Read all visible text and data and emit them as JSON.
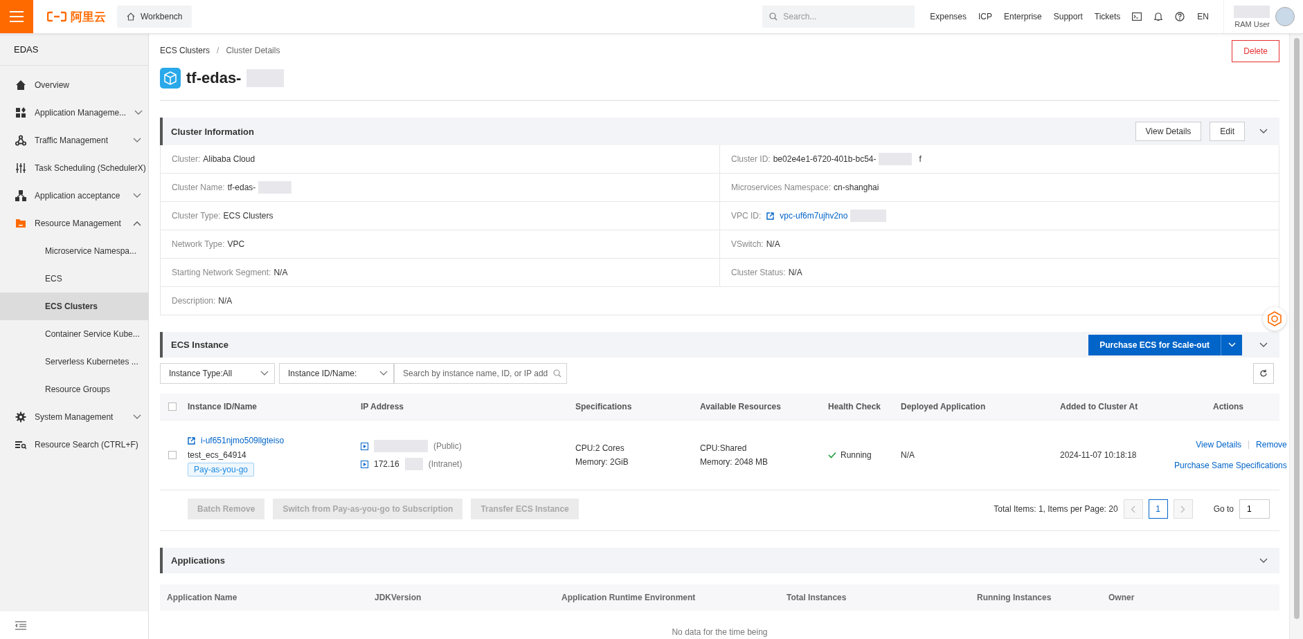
{
  "topbar": {
    "logo_text": "阿里云",
    "workbench": "Workbench",
    "search": {
      "placeholder": "Search..."
    },
    "links": [
      "Expenses",
      "ICP",
      "Enterprise",
      "Support",
      "Tickets"
    ],
    "language": "EN",
    "user_role": "RAM User"
  },
  "sidebar": {
    "title": "EDAS",
    "items": [
      {
        "label": "Overview",
        "kind": "home"
      },
      {
        "label": "Application Manageme...",
        "kind": "apps",
        "expanded": false
      },
      {
        "label": "Traffic Management",
        "kind": "traffic",
        "expanded": false
      },
      {
        "label": "Task Scheduling (SchedulerX)",
        "kind": "sliders"
      },
      {
        "label": "Application acceptance",
        "kind": "nodes",
        "expanded": false
      },
      {
        "label": "Resource Management",
        "kind": "folder",
        "expanded": true,
        "children": [
          {
            "label": "Microservice Namespa...",
            "selected": false
          },
          {
            "label": "ECS",
            "selected": false
          },
          {
            "label": "ECS Clusters",
            "selected": true
          },
          {
            "label": "Container Service Kube...",
            "selected": false
          },
          {
            "label": "Serverless Kubernetes ...",
            "selected": false
          },
          {
            "label": "Resource Groups",
            "selected": false
          }
        ]
      },
      {
        "label": "System Management",
        "kind": "gear",
        "expanded": false
      },
      {
        "label": "Resource Search (CTRL+F)",
        "kind": "searchlist"
      }
    ]
  },
  "breadcrumb": {
    "items": [
      "ECS Clusters",
      "Cluster Details"
    ],
    "separator": "/"
  },
  "title": {
    "text": "tf-edas-",
    "masked": true
  },
  "delete_button": "Delete",
  "cluster_info": {
    "title": "Cluster Information",
    "buttons": [
      "View Details",
      "Edit"
    ],
    "fields": [
      {
        "label": "Cluster:",
        "value": "Alibaba Cloud",
        "kind": "text"
      },
      {
        "label": "Cluster ID:",
        "value": "be02e4e1-6720-401b-bc54-",
        "masked": true,
        "suffix": "f",
        "kind": "text"
      },
      {
        "label": "Cluster Name:",
        "value": "tf-edas-",
        "masked": true,
        "kind": "text"
      },
      {
        "label": "Microservices Namespace:",
        "value": "cn-shanghai",
        "kind": "text"
      },
      {
        "label": "Cluster Type:",
        "value": "ECS Clusters",
        "kind": "text"
      },
      {
        "label": "VPC ID:",
        "value": "vpc-uf6m7ujhv2no",
        "masked": true,
        "kind": "link"
      },
      {
        "label": "Network Type:",
        "value": "VPC",
        "kind": "text"
      },
      {
        "label": "VSwitch:",
        "value": "N/A",
        "kind": "text"
      },
      {
        "label": "Starting Network Segment:",
        "value": "N/A",
        "kind": "text"
      },
      {
        "label": "Cluster Status:",
        "value": "N/A",
        "kind": "text"
      },
      {
        "label": "Description:",
        "value": "N/A",
        "kind": "wide"
      }
    ]
  },
  "ecs_instance": {
    "title": "ECS Instance",
    "purchase_button": "Purchase ECS for Scale-out",
    "filters": [
      "Instance Type:All",
      "Instance ID/Name:"
    ],
    "search": {
      "placeholder": "Search by instance name, ID, or IP add"
    },
    "columns": [
      "Instance ID/Name",
      "IP Address",
      "Specifications",
      "Available Resources",
      "Health Check",
      "Deployed Application",
      "Added to Cluster At",
      "Actions"
    ],
    "header_checked": false,
    "rows": [
      {
        "checked": false,
        "instance_id": "i-uf651njmo509llgteiso",
        "name": "test_ecs_64914",
        "billing": "Pay-as-you-go",
        "ips": [
          {
            "masked": true,
            "tag": "(Public)"
          },
          {
            "address": "172.16",
            "masked": true,
            "tag": "(Intranet)"
          }
        ],
        "specs": [
          "CPU:2 Cores",
          "Memory: 2GiB"
        ],
        "resources": [
          "CPU:Shared",
          "Memory: 2048 MB"
        ],
        "health": "Running",
        "deployed": "N/A",
        "added": "2024-11-07 10:18:18",
        "actions": [
          "View Details",
          "Remove",
          "Purchase Same Specifications"
        ]
      }
    ],
    "footer_buttons": [
      {
        "label": "Batch Remove",
        "disabled": true
      },
      {
        "label": "Switch from Pay-as-you-go to Subscription",
        "disabled": true
      },
      {
        "label": "Transfer ECS Instance",
        "disabled": true
      }
    ],
    "pagination": {
      "summary": "Total Items: 1, Items per Page: 20",
      "pages": [
        {
          "label": "1",
          "selected": true
        }
      ],
      "goto_label": "Go to",
      "goto_value": "1"
    }
  },
  "applications": {
    "title": "Applications",
    "columns": [
      "Application Name",
      "JDKVersion",
      "Application Runtime Environment",
      "Total Instances",
      "Running Instances",
      "Owner"
    ],
    "empty_text": "No data for the time being"
  }
}
